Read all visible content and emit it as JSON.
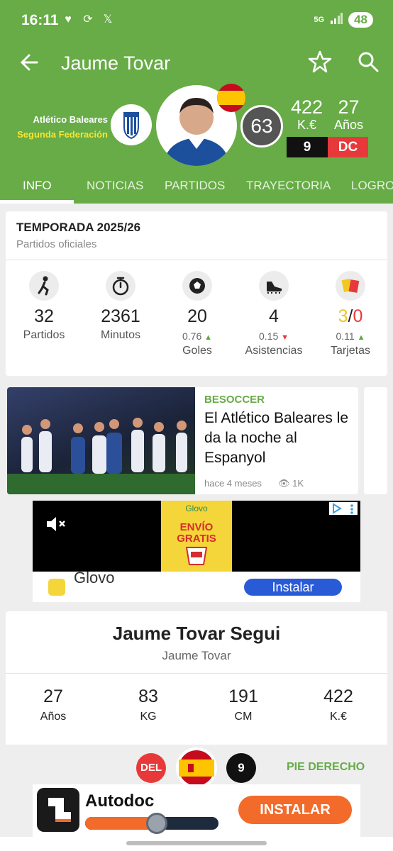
{
  "status_bar": {
    "time": "16:11",
    "network": "5G",
    "battery": "48"
  },
  "header": {
    "title": "Jaume Tovar",
    "team": "Atlético Baleares",
    "league": "Segunda Federación",
    "rating": "63",
    "value": "422",
    "value_label": "K.€",
    "age": "27",
    "age_label": "Años",
    "shirt_number": "9",
    "position": "DC"
  },
  "tabs": [
    "INFO",
    "NOTICIAS",
    "PARTIDOS",
    "TRAYECTORIA",
    "LOGROS"
  ],
  "season": {
    "title": "TEMPORADA 2025/26",
    "subtitle": "Partidos oficiales",
    "stats": [
      {
        "icon": "player-icon",
        "value": "32",
        "label": "Partidos"
      },
      {
        "icon": "stopwatch-icon",
        "value": "2361",
        "label": "Minutos"
      },
      {
        "icon": "ball-icon",
        "value": "20",
        "sub": "0.76",
        "trend": "up",
        "label": "Goles"
      },
      {
        "icon": "boot-icon",
        "value": "4",
        "sub": "0.15",
        "trend": "down",
        "label": "Asistencias"
      },
      {
        "icon": "cards-icon",
        "yellow": "3",
        "red": "0",
        "sub": "0.11",
        "trend": "up",
        "label": "Tarjetas"
      }
    ]
  },
  "news": {
    "source": "BESOCCER",
    "headline": "El Atlético Baleares le da la noche al Espanyol",
    "time": "hace 4 meses",
    "views": "1K"
  },
  "ad_glovo": {
    "brand": "Glovo",
    "promo_line1": "ENVÍO",
    "promo_line2": "GRATIS",
    "bottom_text": "Glovo",
    "install": "Instalar"
  },
  "profile": {
    "full_name": "Jaume Tovar Segui",
    "short_name": "Jaume Tovar",
    "stats": [
      {
        "value": "27",
        "label": "Años"
      },
      {
        "value": "83",
        "label": "KG"
      },
      {
        "value": "191",
        "label": "CM"
      },
      {
        "value": "422",
        "label": "K.€"
      }
    ],
    "position_badge": "DEL",
    "number": "9",
    "foot": "PIE DERECHO"
  },
  "ad_autodoc": {
    "name": "Autodoc",
    "cta": "INSTALAR",
    "progress": 0.55
  },
  "colors": {
    "brand_green": "#67ac46",
    "accent_red": "#e8393a",
    "yellow": "#f6e533"
  }
}
